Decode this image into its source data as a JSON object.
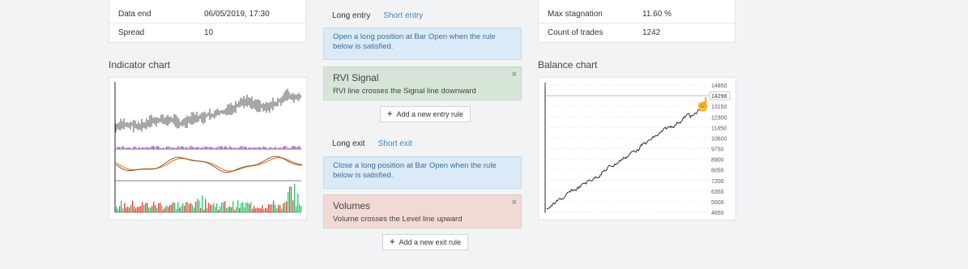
{
  "left_stats": {
    "rows": [
      {
        "label": "Data end",
        "value": "06/05/2019, 17:30"
      },
      {
        "label": "Spread",
        "value": "10"
      }
    ]
  },
  "right_stats": {
    "rows": [
      {
        "label": "Max stagnation",
        "value": "11.60 %"
      },
      {
        "label": "Count of trades",
        "value": "1242"
      }
    ]
  },
  "indicator_chart": {
    "title": "Indicator chart"
  },
  "balance_chart": {
    "title": "Balance chart",
    "y_ticks": [
      "14850",
      "14296",
      "13150",
      "12300",
      "11450",
      "10600",
      "9750",
      "8900",
      "8050",
      "7200",
      "6350",
      "5500",
      "4650"
    ],
    "current_value": "14296"
  },
  "entry": {
    "tab_long": "Long entry",
    "tab_short": "Short entry",
    "info": "Open a long position at Bar Open when the rule below is satisfied.",
    "rule_title": "RVI Signal",
    "rule_desc": "RVI line crosses the Signal line downward",
    "close": "×",
    "add_label": "Add a new entry rule"
  },
  "exit": {
    "tab_long": "Long exit",
    "tab_short": "Short exit",
    "info": "Close a long position at Bar Open when the rule below is satisfied.",
    "rule_title": "Volumes",
    "rule_desc": "Volume crosses the Level line upward",
    "close": "×",
    "add_label": "Add a new exit rule"
  },
  "colors": {
    "link": "#3a87c9",
    "info_bg": "#dbeaf7",
    "rule_green": "#d6e5d8",
    "rule_red": "#f1dad5"
  }
}
